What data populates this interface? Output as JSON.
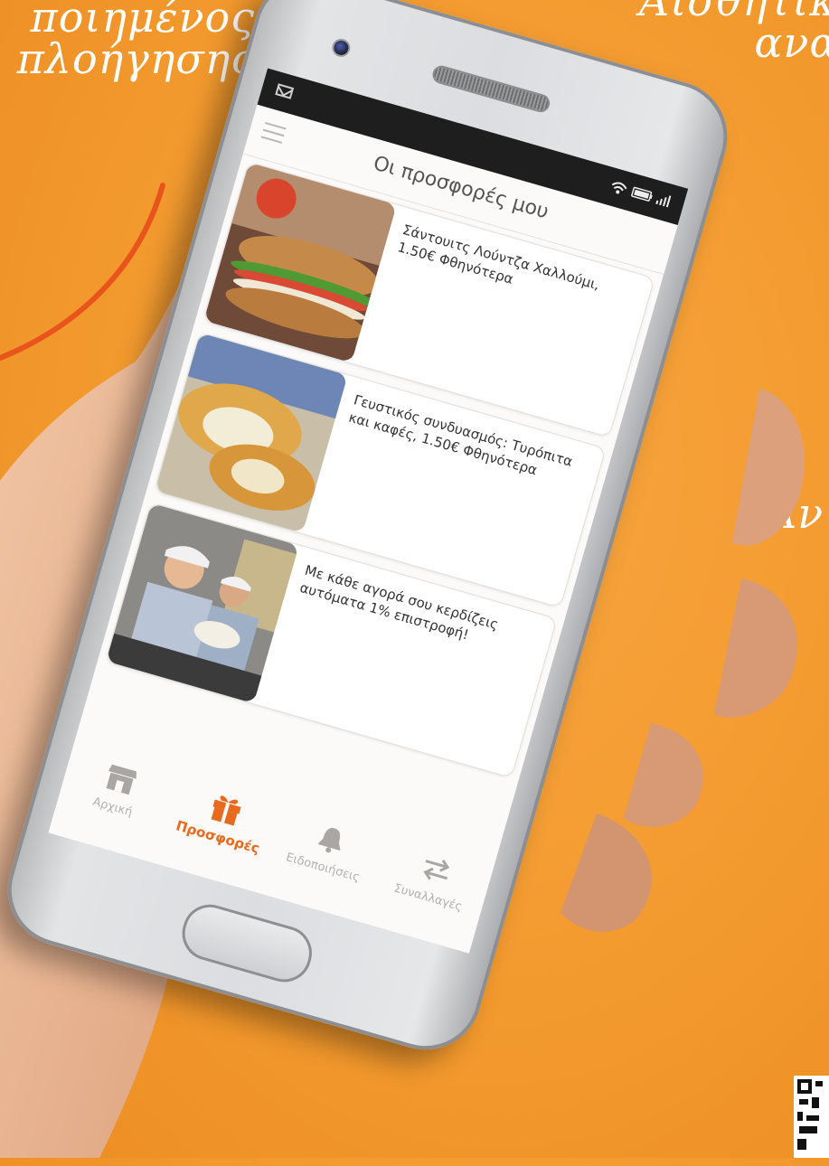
{
  "headlines": {
    "left_line1": "ποιημένος",
    "left_line2": "πλοήγησης",
    "right_line1": "Αισθητική",
    "right_line2": "αναβ",
    "mid": "Αν"
  },
  "status_bar": {
    "left_icon": "mail-icon",
    "right_icons": [
      "wifi-icon",
      "battery-icon",
      "signal-icon"
    ]
  },
  "app": {
    "menu_icon": "hamburger-menu-icon",
    "title": "Οι προσφορές μου",
    "offers": [
      {
        "text": "Σάντουιτς Λούντζα Χαλλούμι, 1.50€ Φθηνότερα",
        "image": "sandwich-photo"
      },
      {
        "text": "Γευστικός συνδυασμός: Τυρόπιτα και καφές, 1.50€ Φθηνότερα",
        "image": "cheese-pie-photo"
      },
      {
        "text": "Με κάθε αγορά σου κερδίζεις αυτόματα 1% επιστροφή!",
        "image": "staff-photo"
      }
    ],
    "bottom_nav": [
      {
        "label": "Αρχική",
        "icon": "store-icon",
        "active": false
      },
      {
        "label": "Προσφορές",
        "icon": "gift-icon",
        "active": true
      },
      {
        "label": "Ειδοποιήσεις",
        "icon": "bell-icon",
        "active": false
      },
      {
        "label": "Συναλλαγές",
        "icon": "transfer-arrows-icon",
        "active": false
      }
    ]
  },
  "colors": {
    "background": "#f39a2e",
    "accent": "#e86a1e",
    "inactive": "#b4b1ae",
    "statusbar": "#1e1e1e"
  }
}
